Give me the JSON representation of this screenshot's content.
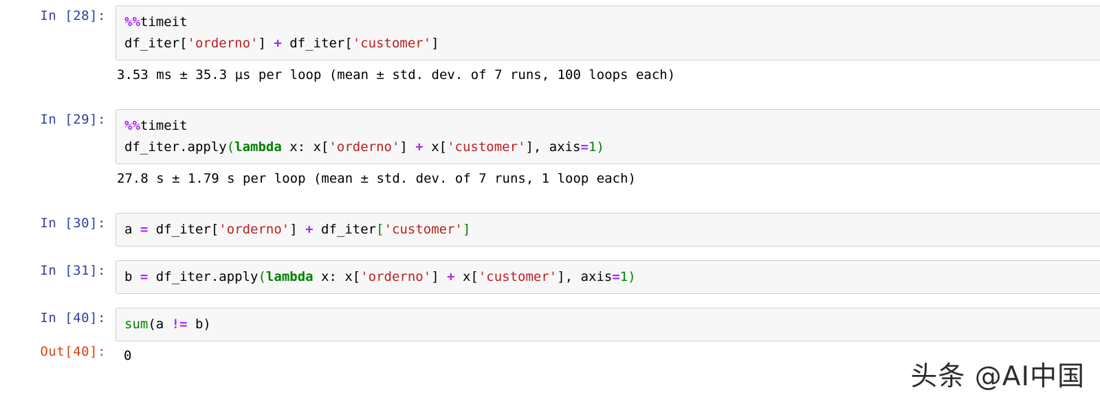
{
  "notebook": {
    "cells": [
      {
        "kind": "code",
        "prompt": "In [28]:",
        "lines": [
          [
            {
              "t": "%%",
              "c": "magic"
            },
            {
              "t": "timeit",
              "c": "plain"
            }
          ],
          [
            {
              "t": "df_iter[",
              "c": "plain"
            },
            {
              "t": "'orderno'",
              "c": "string"
            },
            {
              "t": "] ",
              "c": "plain"
            },
            {
              "t": "+",
              "c": "operator"
            },
            {
              "t": " df_iter[",
              "c": "plain"
            },
            {
              "t": "'customer'",
              "c": "string"
            },
            {
              "t": "]",
              "c": "plain"
            }
          ]
        ],
        "output": {
          "kind": "stream",
          "text": "3.53 ms ± 35.3 µs per loop (mean ± std. dev. of 7 runs, 100 loops each)"
        }
      },
      {
        "kind": "code",
        "prompt": "In [29]:",
        "lines": [
          [
            {
              "t": "%%",
              "c": "magic"
            },
            {
              "t": "timeit",
              "c": "plain"
            }
          ],
          [
            {
              "t": "df_iter.apply",
              "c": "plain"
            },
            {
              "t": "(",
              "c": "punct-g"
            },
            {
              "t": "lambda",
              "c": "keyword"
            },
            {
              "t": " x: x[",
              "c": "plain"
            },
            {
              "t": "'orderno'",
              "c": "string"
            },
            {
              "t": "] ",
              "c": "plain"
            },
            {
              "t": "+",
              "c": "operator"
            },
            {
              "t": " x[",
              "c": "plain"
            },
            {
              "t": "'customer'",
              "c": "string"
            },
            {
              "t": "], axis",
              "c": "plain"
            },
            {
              "t": "=",
              "c": "operator"
            },
            {
              "t": "1",
              "c": "number"
            },
            {
              "t": ")",
              "c": "punct-g"
            }
          ]
        ],
        "output": {
          "kind": "stream",
          "text": "27.8 s ± 1.79 s per loop (mean ± std. dev. of 7 runs, 1 loop each)"
        }
      },
      {
        "kind": "code",
        "prompt": "In [30]:",
        "lines": [
          [
            {
              "t": "a ",
              "c": "plain"
            },
            {
              "t": "=",
              "c": "operator"
            },
            {
              "t": " df_iter[",
              "c": "plain"
            },
            {
              "t": "'orderno'",
              "c": "string"
            },
            {
              "t": "] ",
              "c": "plain"
            },
            {
              "t": "+",
              "c": "operator"
            },
            {
              "t": " df_iter",
              "c": "plain"
            },
            {
              "t": "[",
              "c": "punct-g"
            },
            {
              "t": "'customer'",
              "c": "string"
            },
            {
              "t": "]",
              "c": "punct-g"
            }
          ]
        ],
        "output": null
      },
      {
        "kind": "code",
        "prompt": "In [31]:",
        "lines": [
          [
            {
              "t": "b ",
              "c": "plain"
            },
            {
              "t": "=",
              "c": "operator"
            },
            {
              "t": " df_iter.apply",
              "c": "plain"
            },
            {
              "t": "(",
              "c": "punct-g"
            },
            {
              "t": "lambda",
              "c": "keyword"
            },
            {
              "t": " x: x[",
              "c": "plain"
            },
            {
              "t": "'orderno'",
              "c": "string"
            },
            {
              "t": "] ",
              "c": "plain"
            },
            {
              "t": "+",
              "c": "operator"
            },
            {
              "t": " x[",
              "c": "plain"
            },
            {
              "t": "'customer'",
              "c": "string"
            },
            {
              "t": "], axis",
              "c": "plain"
            },
            {
              "t": "=",
              "c": "operator"
            },
            {
              "t": "1",
              "c": "number"
            },
            {
              "t": ")",
              "c": "punct-g"
            }
          ]
        ],
        "output": null
      },
      {
        "kind": "code",
        "prompt": "In [40]:",
        "lines": [
          [
            {
              "t": "sum",
              "c": "builtin"
            },
            {
              "t": "(a ",
              "c": "plain"
            },
            {
              "t": "!=",
              "c": "operator"
            },
            {
              "t": " b)",
              "c": "plain"
            }
          ]
        ],
        "output": {
          "kind": "result",
          "prompt": "Out[40]:",
          "text": "0"
        }
      }
    ]
  },
  "watermark": {
    "text": "头条 @AI中国"
  },
  "colors": {
    "in_prompt": "#303F9F",
    "out_prompt": "#D84315",
    "cell_background": "#f7f7f7",
    "cell_border": "#cfcfcf",
    "string": "#BA2121",
    "operator": "#AA22FF",
    "keyword": "#008000",
    "builtin": "#008000",
    "number": "#008000",
    "text": "#000000",
    "page_background": "#ffffff"
  }
}
